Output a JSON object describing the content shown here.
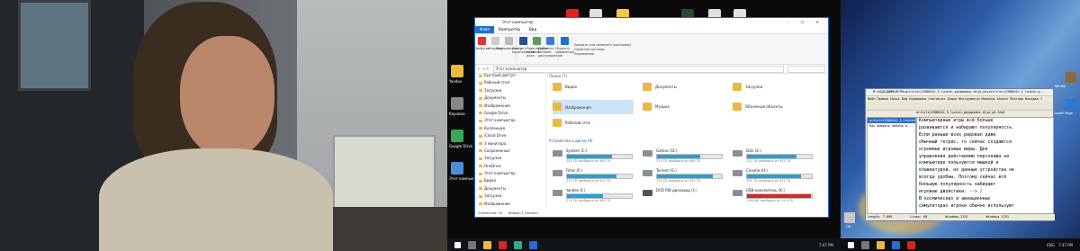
{
  "explorer": {
    "title": "Этот компьютер",
    "tabs": [
      "Файл",
      "Компьютер",
      "Вид"
    ],
    "ribbon": {
      "buttons": [
        "Свойства",
        "Открыть",
        "Переименовать",
        "Доступ к мультимедиа",
        "Подключить сетевой диск",
        "Добавить сетевое расположение",
        "Открыть параметры",
        "Удалить или изменить программу",
        "Свойства системы",
        "Управление"
      ],
      "groups": [
        "Расположение",
        "Сеть",
        "Система"
      ]
    },
    "address": "Этот компьютер",
    "nav_items": [
      "Быстрый доступ",
      "Рабочий стол",
      "Загрузки",
      "Документы",
      "Изображения",
      "Google Drive",
      "Этот компьютер",
      "Коллекция",
      "iCloud Drive",
      "3 монитора",
      "Сохраненные",
      "Загрузки",
      "OneDrive",
      "Этот компьютер",
      "Видео",
      "Документы",
      "Загрузки",
      "Изображения"
    ],
    "sections": {
      "folders": "Папки (7)",
      "drives": "Устройства и диски (9)"
    },
    "folders": [
      "Видео",
      "Документы",
      "Загрузки",
      "Изображения",
      "Музыка",
      "Объемные объекты",
      "Рабочий стол"
    ],
    "drives": [
      {
        "name": "System (C:)",
        "free": "143 ГБ свободно из 465 ГБ",
        "used": 0.69
      },
      {
        "name": "Games (D:)",
        "free": "153 ГБ свободно из 465 ГБ",
        "used": 0.67
      },
      {
        "name": "Disk (E:)",
        "free": "212 ГБ свободно из 931 ГБ",
        "used": 0.77
      },
      {
        "name": "Films (F:)",
        "free": "212 ГБ свободно из 931 ГБ",
        "used": 0.77
      },
      {
        "name": "Torrent (G:)",
        "free": "134 ГБ свободно из 931 ГБ",
        "used": 0.86
      },
      {
        "name": "Cinema (H:)",
        "free": "155 ГБ свободно из 931 ГБ",
        "used": 0.83
      },
      {
        "name": "Yandex (I:)",
        "free": "211 ГБ свободно из 465 ГБ",
        "used": 0.55
      },
      {
        "name": "DVD RW дисковод (I:)",
        "free": "",
        "used": 0
      },
      {
        "name": "USB-накопитель (K:)",
        "free": "1.88 МБ свободно из 14.4 ГБ",
        "used": 0.99,
        "warning": true
      }
    ],
    "status": [
      "Элементов: 16",
      "Выбран 1 элемент"
    ]
  },
  "editor": {
    "title": "Ф:\\КОД\\ДИФФ\\ИГРЫ\\article\\12986542_5_luchsh_geympadov_dlya_pk\\article\\12986542_5_luchsh_g...",
    "menu": [
      "Файл",
      "Правка",
      "Поиск",
      "Вид",
      "Кодировки",
      "Синтаксис",
      "Опции",
      "Инструменты",
      "Макросы",
      "Запуск",
      "Плагины",
      "Вкладки",
      "?"
    ],
    "tab": "article12986542_5_luchsh_geympadov_dlya_pk.html",
    "list": [
      "article12986542_5_luchsh_g",
      "Как выбрать мебель в..."
    ],
    "text_lines": [
      "Компьютерные игры всё больше",
      "развиваются и набирают популярность.",
      "Если раньше всех радовал даже",
      "обычный тетрис, то сейчас создаются",
      "огромные игровые миры. Для",
      "управления действиями персонажа на",
      "компьютере пользуются мышкой и",
      "клавиатурой, но данные устройства не",
      "всегда удобны. Поэтому сейчас всё",
      "большую популярность набирают",
      "игровые джойстики.  -->  /",
      "В космических и авиационных",
      "симуляторах игроки обычно используют"
    ],
    "status": [
      "Length: 7,090",
      "Lines: 68",
      "Windows-1251",
      "Windows 1251"
    ]
  },
  "taskbar": {
    "time_center": "7:47 PM",
    "time_right": "7:47 PM",
    "lang": "ENG"
  },
  "desktop_left_labels": [
    "Yandex",
    "Корзина",
    "Google Drive",
    "Этот компьютер"
  ],
  "desktop_right_labels": [
    "WinRar",
    "Microsoft Edge",
    "ПК"
  ],
  "colors": {
    "accent": "#1a73c8",
    "drive_bar": "#26a0da",
    "drive_warn": "#da2626"
  }
}
